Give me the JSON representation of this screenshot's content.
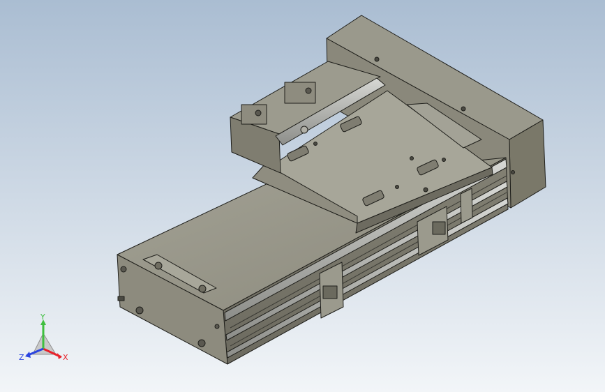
{
  "viewport": {
    "background_top": "#aabdd2",
    "background_bottom": "#f2f5f8"
  },
  "model": {
    "body_color": "#8c8a7d",
    "body_light": "#a9a89c",
    "body_dark": "#5e5c52",
    "rail_color": "#b9bab6",
    "edge_color": "#1e1e1a"
  },
  "triad": {
    "x_label": "X",
    "y_label": "Y",
    "z_label": "Z",
    "x_color": "#e8212a",
    "y_color": "#3fbf3f",
    "z_color": "#2a44e0"
  }
}
